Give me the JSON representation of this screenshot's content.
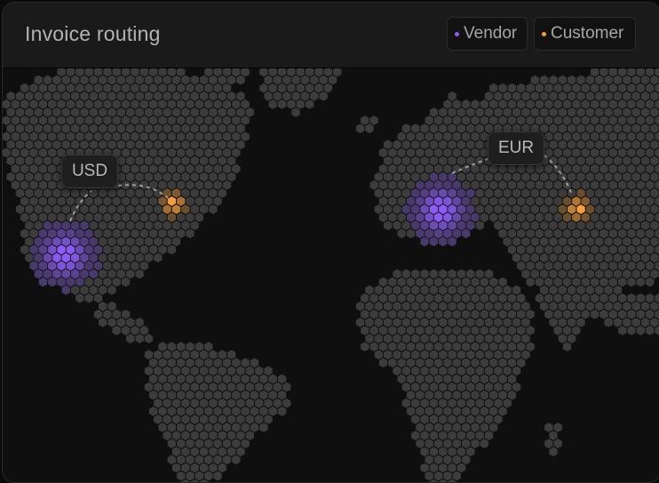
{
  "title": "Invoice routing",
  "legend": {
    "vendor": {
      "label": "Vendor",
      "color": "#8b5cf6"
    },
    "customer": {
      "label": "Customer",
      "color": "#f59e3b"
    }
  },
  "routes": [
    {
      "currency": "USD",
      "from": "vendor",
      "to": "customer",
      "from_region": "western North America",
      "to_region": "eastern North America"
    },
    {
      "currency": "EUR",
      "from": "vendor",
      "to": "customer",
      "from_region": "western Europe",
      "to_region": "Russia"
    }
  ],
  "colors": {
    "land_dot": "#3c3c3c",
    "vendor": "#8b5cf6",
    "customer": "#f59e3b",
    "route_line": "#bfbfbf"
  }
}
